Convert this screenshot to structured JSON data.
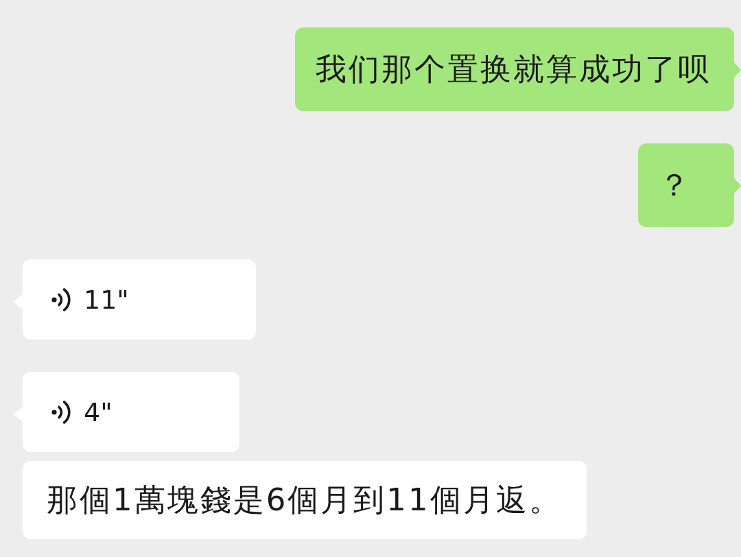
{
  "messages": [
    {
      "outgoing": true,
      "kind": "text",
      "text": "我们那个置换就算成功了呗",
      "tail": true
    },
    {
      "outgoing": true,
      "kind": "text",
      "text": "？",
      "tail": true
    },
    {
      "outgoing": false,
      "kind": "voice",
      "duration": "11\"",
      "tail": true
    },
    {
      "outgoing": false,
      "kind": "voice",
      "duration": "4\"",
      "tail": true
    },
    {
      "outgoing": false,
      "kind": "text",
      "text": "那個1萬塊錢是6個月到11個月返。",
      "tail": false
    }
  ]
}
